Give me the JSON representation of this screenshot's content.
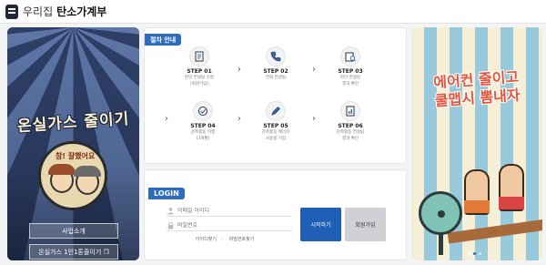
{
  "header": {
    "brand_prefix": "우리집",
    "brand_name": "탄소가계부"
  },
  "left_banner": {
    "title": "온실가스 줄이기",
    "badge": "참! 잘했어요",
    "buttons": [
      "사업소개",
      "온실가스 1인1톤줄이기 ❐"
    ]
  },
  "process": {
    "tag": "절차 안내",
    "steps": [
      {
        "title": "STEP 01",
        "desc1": "탄단 컨설팅 신청",
        "desc2": "(회원가입)"
      },
      {
        "title": "STEP 02",
        "desc1": "전화 컨설팅",
        "desc2": ""
      },
      {
        "title": "STEP 03",
        "desc1": "탄단 컨설팅",
        "desc2": "결과 확인"
      },
      {
        "title": "STEP 04",
        "desc1": "감축활동 이행",
        "desc2": "(3개월)"
      },
      {
        "title": "STEP 05",
        "desc1": "감축활동 에너지",
        "desc2": "사용량 기입"
      },
      {
        "title": "STEP 06",
        "desc1": "감축활동 컨설팅",
        "desc2": "결과 확인"
      }
    ]
  },
  "login": {
    "title": "LOGIN",
    "email_placeholder": "이메일 아이디",
    "password_placeholder": "비밀번호",
    "find_id": "아이디찾기",
    "find_password": "비밀번호찾기",
    "login_button": "시작하기",
    "join_button": "회원가입"
  },
  "right_banner": {
    "title_line1": "에어컨 줄이고",
    "title_line2": "쿨맵시 뽐내자"
  },
  "colors": {
    "accent": "#2d6cc0",
    "login_button": "#1f5fb5"
  }
}
